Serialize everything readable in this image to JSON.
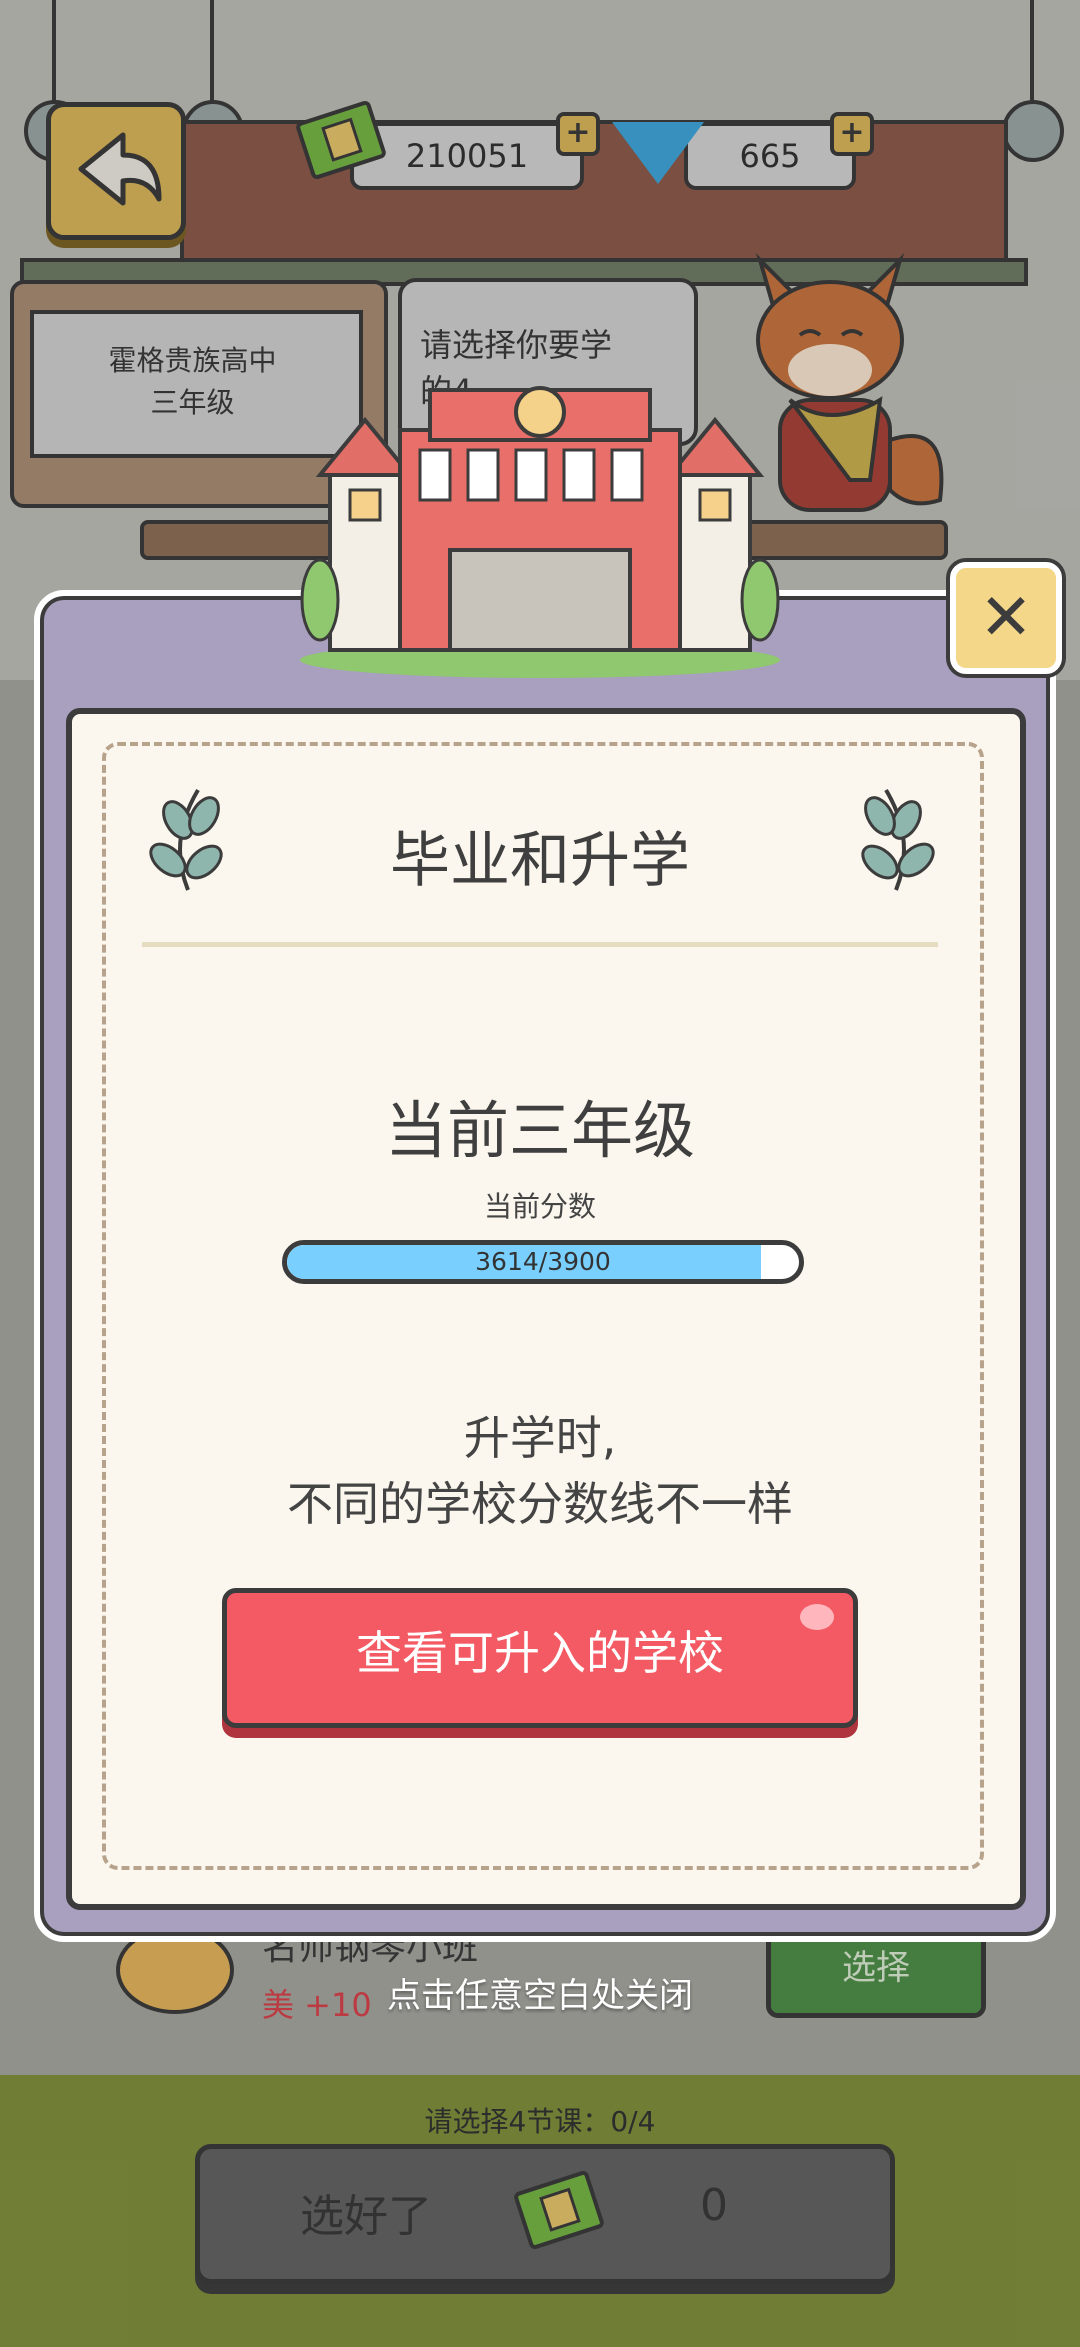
{
  "top_bar": {
    "money": "210051",
    "gems": "665",
    "plus_symbol": "+"
  },
  "scene": {
    "board_line1": "霍格贵族高中",
    "board_line2": "三年级",
    "bubble_line1": "请选择你要学",
    "bubble_line2": "的4"
  },
  "modal": {
    "close_symbol": "✕",
    "title": "毕业和升学",
    "grade": "当前三年级",
    "score_label": "当前分数",
    "score_text": "3614/3900",
    "score_current": 3614,
    "score_max": 3900,
    "hint_line1": "升学时,",
    "hint_line2": "不同的学校分数线不一样",
    "view_schools_button": "查看可升入的学校"
  },
  "background_list": {
    "course_name": "名师钢琴小班",
    "course_bonus": "美 +10",
    "select_button": "选择"
  },
  "dismiss_hint": "点击任意空白处关闭",
  "footer": {
    "count_label": "请选择4节课：0/4",
    "done_button": "选好了",
    "done_cost": "0"
  },
  "colors": {
    "primary_button": "#f35a63",
    "progress_fill": "#79d0ff",
    "modal_frame": "#a99fbf"
  }
}
